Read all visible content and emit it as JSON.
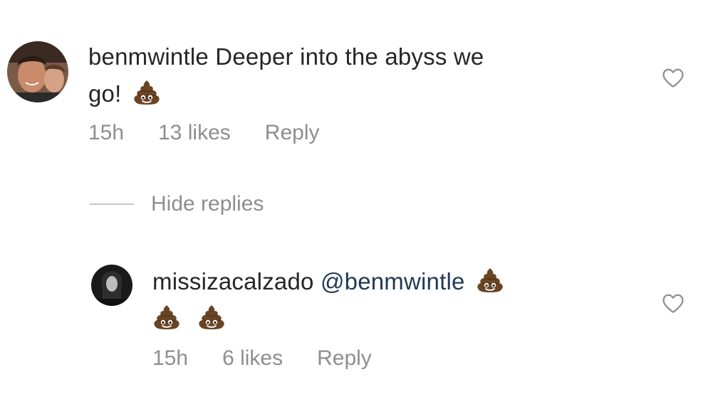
{
  "comment": {
    "username": "benmwintle",
    "text_line1": "Deeper into the abyss we",
    "text_line2": "go!",
    "time": "15h",
    "likes": "13 likes",
    "reply_label": "Reply",
    "emoji_icon": "pile-of-poo-emoji"
  },
  "thread": {
    "hide_replies_label": "Hide replies"
  },
  "reply": {
    "username": "missizacalzado",
    "mention": "@benmwintle",
    "time": "15h",
    "likes": "6 likes",
    "reply_label": "Reply",
    "emoji_icon": "pile-of-poo-emoji"
  },
  "colors": {
    "meta_text": "#8e8e8e",
    "body_text": "#262626",
    "mention": "#1f3a5a",
    "heart_outline": "#8e8e8e"
  }
}
